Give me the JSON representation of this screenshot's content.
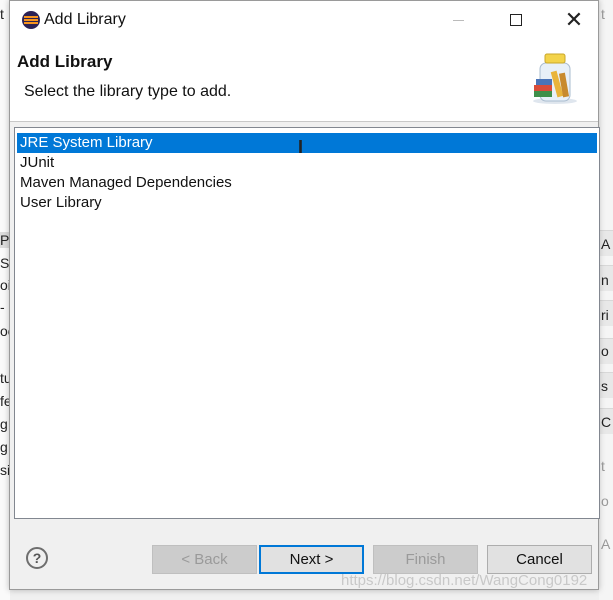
{
  "window": {
    "title": "Add Library"
  },
  "header": {
    "title": "Add Library",
    "description": "Select the library type to add."
  },
  "library_types": [
    {
      "label": "JRE System Library",
      "selected": true
    },
    {
      "label": "JUnit",
      "selected": false
    },
    {
      "label": "Maven Managed Dependencies",
      "selected": false
    },
    {
      "label": "User Library",
      "selected": false
    }
  ],
  "buttons": {
    "help": "?",
    "back": "< Back",
    "next": "Next >",
    "finish": "Finish",
    "cancel": "Cancel"
  },
  "background": {
    "left_fragments": [
      "t",
      "P",
      "S",
      "oi",
      "-",
      "oo",
      "tu",
      "fe",
      "g",
      "g",
      "si"
    ],
    "right_fragments": [
      "t",
      "A",
      "n",
      "ri",
      "o",
      "s",
      "C",
      "t",
      "o",
      "A"
    ]
  },
  "watermark": "https://blog.csdn.net/WangCong0192",
  "colors": {
    "selection": "#0078d7",
    "default_button_border": "#0078d7"
  }
}
